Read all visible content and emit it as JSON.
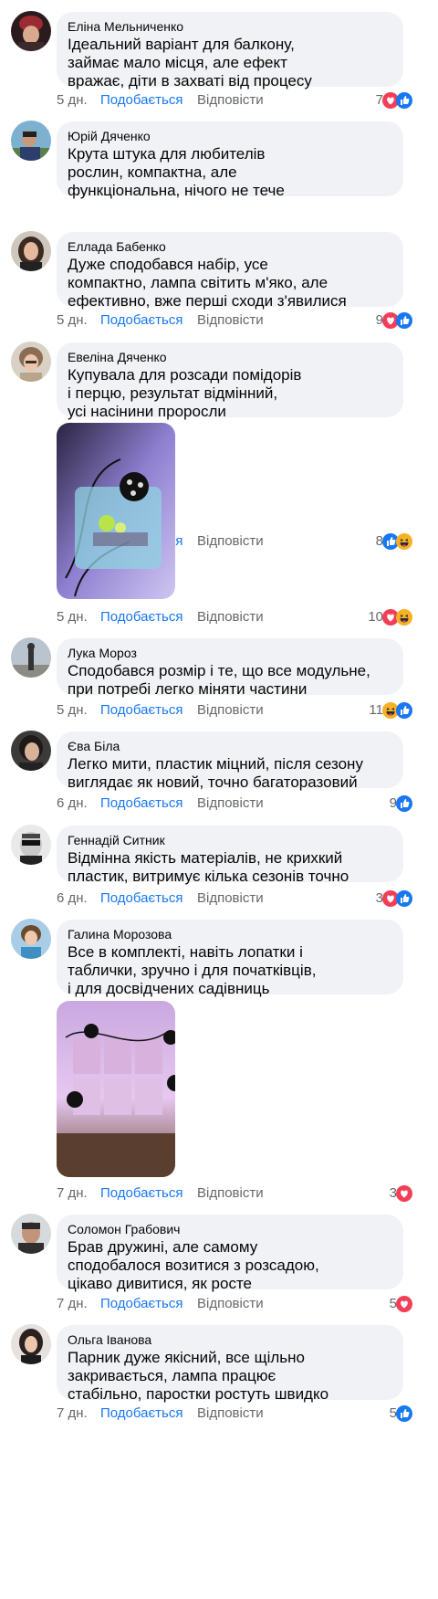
{
  "colors": {
    "like_blue": "#1877f2",
    "love_red": "#f33e58",
    "haha_yellow": "#f7b125",
    "muted": "#65676b",
    "bubble": "#f0f2f5"
  },
  "comments": [
    {
      "author": "Еліна Мельниченко",
      "text": "Ідеальний варіант для балкону,\nзаймає мало місця, але ефект\nвражає, діти в захваті від процесу",
      "time": "5 дн.",
      "like_label": "Подобається",
      "reply_label": "Відповісти",
      "reaction_count": "7",
      "reactions": [
        "love-icon",
        "like-icon"
      ]
    },
    {
      "author": "Юрій Дяченко",
      "text": "Крута штука для любителів\nрослин, компактна, але\nфункціональна, нічого не тече",
      "time": "5 дн.",
      "like_label": "Подобається",
      "reply_label": "Відповісти",
      "reaction_count": "9",
      "reactions": [
        "love-icon",
        "like-icon"
      ]
    },
    {
      "author": "Еллада Бабенко",
      "text": "Дуже сподобався набір, усе\nкомпактно, лампа світить м'яко, але\nефективно, вже перші сходи з'явилися",
      "time": "5 дн.",
      "like_label": "Подобається",
      "reply_label": "Відповісти",
      "reaction_count": "8",
      "reactions": [
        "like-icon",
        "haha-icon"
      ]
    },
    {
      "author": "Евеліна Дяченко",
      "text": "Купувала для розсади помідорів\nі перцю, результат відмінний,\nусі насінини проросли",
      "time": "5 дн.",
      "like_label": "Подобається",
      "reply_label": "Відповісти",
      "reaction_count": "10",
      "reactions": [
        "love-icon",
        "haha-icon"
      ],
      "photo": "seedling-box-photo"
    },
    {
      "author": "Лука Мороз",
      "text": "Сподобався розмір і те, що все модульне,\nпри потребі легко міняти частини",
      "time": "5 дн.",
      "like_label": "Подобається",
      "reply_label": "Відповісти",
      "reaction_count": "11",
      "reactions": [
        "haha-icon",
        "like-icon"
      ]
    },
    {
      "author": "Єва Біла",
      "text": "Легко мити, пластик міцний, після сезону\nвиглядає як новий, точно багаторазовий",
      "time": "6 дн.",
      "like_label": "Подобається",
      "reply_label": "Відповісти",
      "reaction_count": "9",
      "reactions": [
        "like-icon"
      ]
    },
    {
      "author": "Геннадій Ситник",
      "text": "Відмінна якість матеріалів, не крихкий\nпластик, витримує кілька сезонів точно",
      "time": "6 дн.",
      "like_label": "Подобається",
      "reply_label": "Відповісти",
      "reaction_count": "3",
      "reactions": [
        "love-icon",
        "like-icon"
      ]
    },
    {
      "author": "Галина Морозова",
      "text": "Все в комплекті, навіть лопатки і\nтаблички, зручно і для початківців,\nі для досвідчених садівниць",
      "time": "7 дн.",
      "like_label": "Подобається",
      "reply_label": "Відповісти",
      "reaction_count": "3",
      "reactions": [
        "love-icon"
      ],
      "photo": "grow-trays-photo"
    },
    {
      "author": "Соломон Грабович",
      "text": "Брав дружині, але самому\nсподобалося возитися з розсадою,\nцікаво дивитися, як росте",
      "time": "7 дн.",
      "like_label": "Подобається",
      "reply_label": "Відповісти",
      "reaction_count": "5",
      "reactions": [
        "love-icon"
      ]
    },
    {
      "author": "Ольга Іванова",
      "text": "Парник дуже якісний, все щільно\nзакривається, лампа працює\nстабільно, паростки ростуть швидко",
      "time": "7 дн.",
      "like_label": "Подобається",
      "reply_label": "Відповісти",
      "reaction_count": "5",
      "reactions": [
        "like-icon"
      ]
    }
  ]
}
